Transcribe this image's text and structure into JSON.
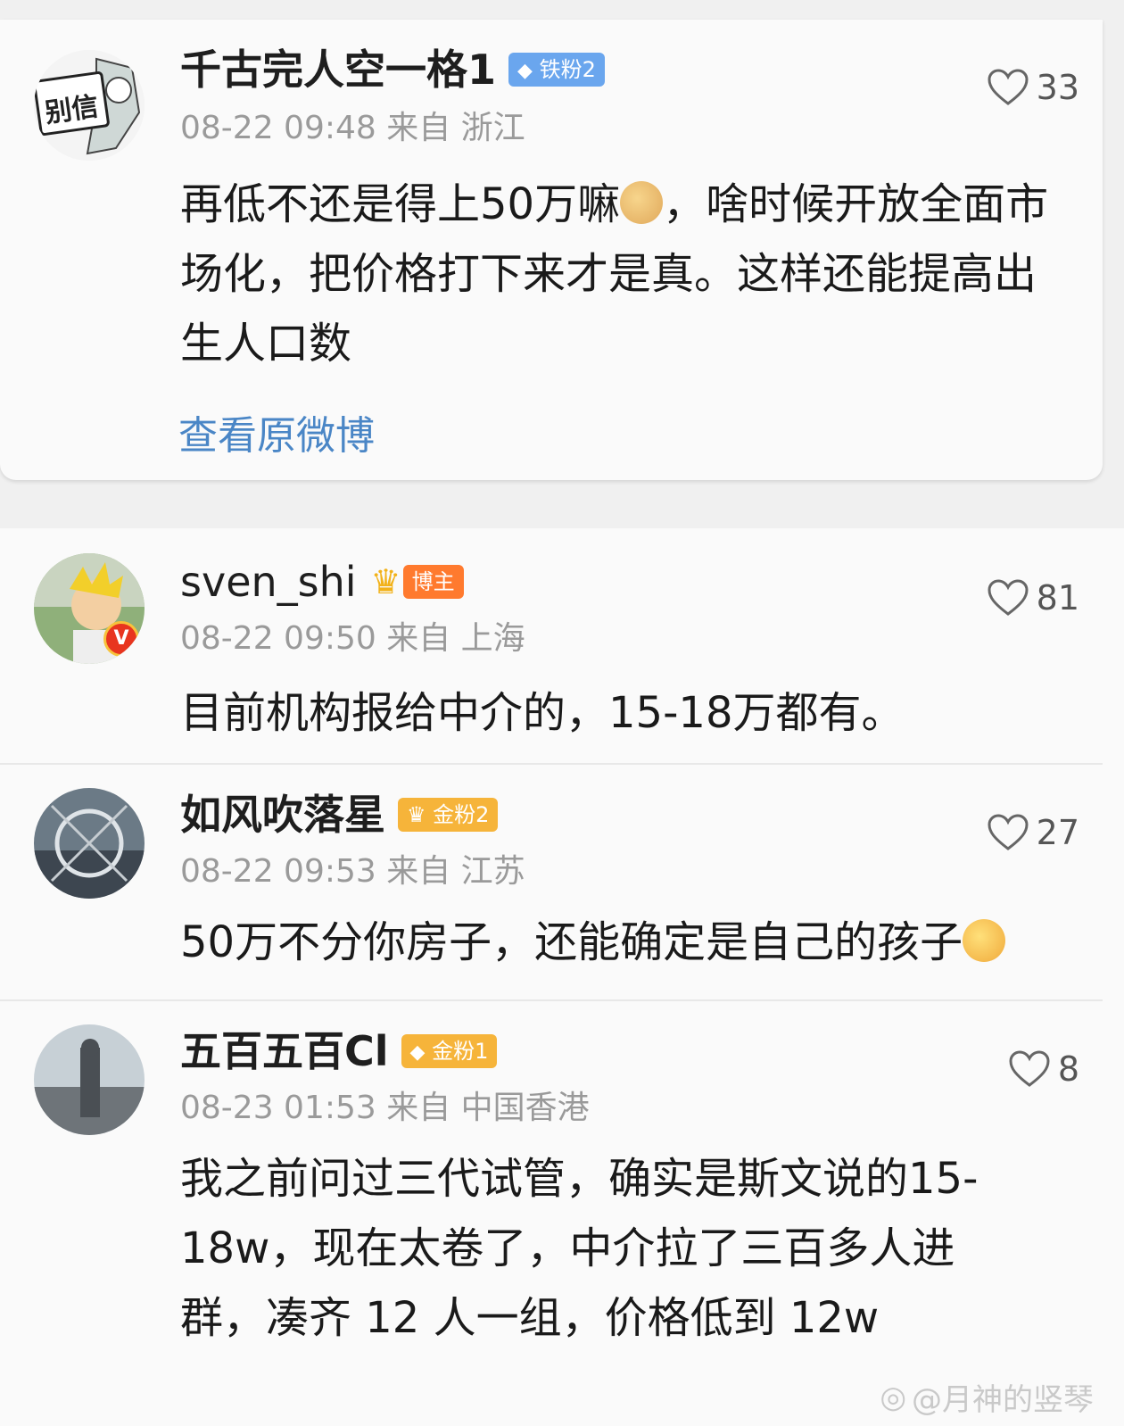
{
  "comments": [
    {
      "username": "千古完人空一格1",
      "badge": "铁粉2",
      "badge_color": "#6aa6ee",
      "meta": "08-22 09:48 来自 浙江",
      "text_before_emoji": "再低不还是得上50万嘛",
      "text_after_emoji": "，啥时候开放全面市场化，把价格打下来才是真。这样还能提高出生人口数",
      "likes": "33",
      "avatar_text": "别信",
      "link": "查看原微博"
    },
    {
      "username": "sven_shi",
      "badge": "博主",
      "badge_color": "#ff7a2e",
      "meta": "08-22 09:50 来自 上海",
      "text": "目前机构报给中介的，15-18万都有。",
      "likes": "81"
    },
    {
      "username": "如风吹落星",
      "badge": "金粉2",
      "badge_color": "#f6b43a",
      "meta": "08-22 09:53 来自 江苏",
      "text": "50万不分你房子，还能确定是自己的孩子",
      "likes": "27"
    },
    {
      "username": "五百五百Cl",
      "badge": "金粉1",
      "badge_color": "#f6b43a",
      "meta": "08-23 01:53 来自 中国香港",
      "text": "我之前问过三代试管，确实是斯文说的15-18w，现在太卷了，中介拉了三百多人进群，凑齐 12 人一组，价格低到 12w",
      "likes": "8"
    }
  ],
  "watermark": "@月神的竖琴"
}
